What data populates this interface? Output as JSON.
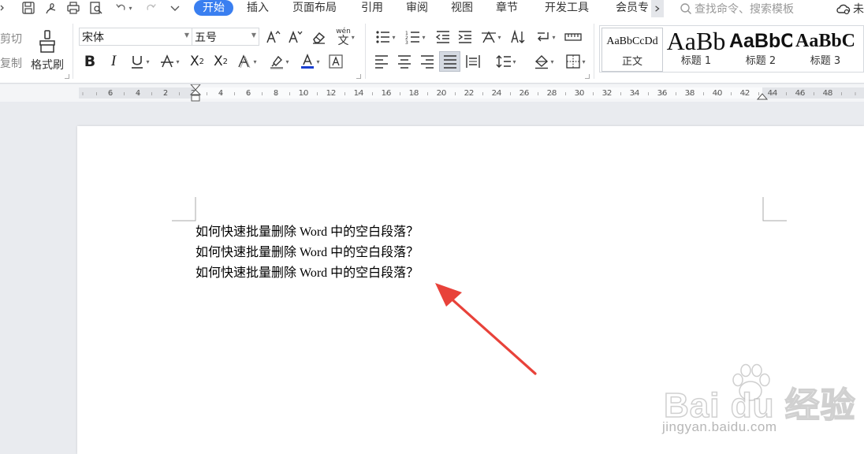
{
  "tabs": [
    {
      "label": "开始",
      "active": true
    },
    {
      "label": "插入"
    },
    {
      "label": "页面布局"
    },
    {
      "label": "引用"
    },
    {
      "label": "审阅"
    },
    {
      "label": "视图"
    },
    {
      "label": "章节"
    },
    {
      "label": "开发工具"
    },
    {
      "label": "会员专"
    }
  ],
  "search": {
    "placeholder": "查找命令、搜索模板"
  },
  "cloud": {
    "label": "未"
  },
  "clipboard": {
    "cut_label": "剪切",
    "copy_label": "复制",
    "format_painter_label": "格式刷"
  },
  "font": {
    "family": "宋体",
    "size": "五号"
  },
  "phonetic": {
    "label": "wén"
  },
  "styles": [
    {
      "preview": "AaBbCcDd",
      "name": "正文",
      "selected": true
    },
    {
      "preview": "AaBb",
      "name": "标题 1"
    },
    {
      "preview": "AaBbC",
      "name": "标题 2"
    },
    {
      "preview": "AaBbC",
      "name": "标题 3"
    }
  ],
  "ruler": {
    "labels": [
      "6",
      "4",
      "2",
      "2",
      "4",
      "6",
      "8",
      "10",
      "12",
      "14",
      "16",
      "18",
      "20",
      "22",
      "24",
      "26",
      "28",
      "30",
      "32",
      "34",
      "36",
      "38",
      "40",
      "42",
      "44",
      "46",
      "48"
    ]
  },
  "document": {
    "lines": [
      "如何快速批量删除 Word 中的空白段落？",
      "如何快速批量删除 Word 中的空白段落？",
      "如何快速批量删除 Word 中的空白段落？"
    ]
  },
  "annotation": {
    "color": "#e8423a"
  },
  "watermark": {
    "logo": "Bai  du 经验",
    "url": "jingyan.baidu.com"
  },
  "colors": {
    "accent": "#3a7ff0",
    "font_color_bar": "#1a3fd0"
  }
}
